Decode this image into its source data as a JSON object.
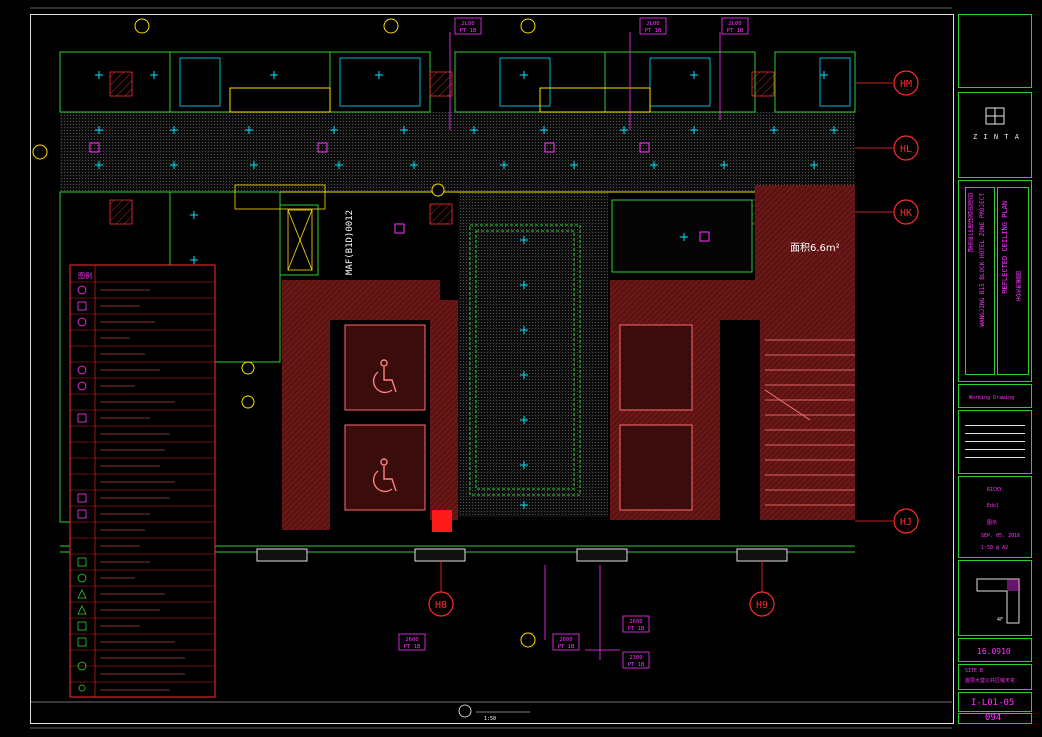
{
  "drawing": {
    "area_label": "面积6.6m²",
    "equipment_tag": "MAF(B1D)0012",
    "grid_lines_right": [
      "HM",
      "HL",
      "HK",
      "HJ"
    ],
    "grid_lines_bottom": [
      "H8",
      "H9"
    ],
    "ceiling_tags_top": [
      {
        "height": "2L00",
        "code": "PT 1B"
      },
      {
        "height": "2L00",
        "code": "PT 1B"
      },
      {
        "height": "2L00",
        "code": "PT 1B"
      }
    ],
    "ceiling_tags_bottom": [
      {
        "height": "2600",
        "code": "PT 1B"
      },
      {
        "height": "2600",
        "code": "PT 1B"
      },
      {
        "height": "2600",
        "code": "PT 1B"
      },
      {
        "height": "2300",
        "code": "PT 1B"
      }
    ],
    "legend_title": "图例",
    "scale_label": "1:50"
  },
  "title_block": {
    "firm_label": "",
    "firm_name": "Z I N T A",
    "project_cn": "望京B15地块酒店项目",
    "project_en": "WANGJING B15 BLOCK HOTEL ZONE PROJECT",
    "drawing_title_en": "REFLECTED CEILING PLAN",
    "drawing_title_cn": "天花布置图",
    "status_label": "",
    "status": "Working Drawing",
    "drawn": "RICKY",
    "checked": "Edol",
    "scale": "图示",
    "date": "SEP. 05. 2016",
    "sheet_size": "1:50 @ A2",
    "key_plan_label": "4F",
    "project_no": "16.0910",
    "area_code": "SITE B",
    "area_desc": "首层大堂公共区域天花",
    "sheet_no": "I-L01-05",
    "page_no": "094"
  },
  "colors": {
    "frame": "#e0e0e0",
    "green": "#2bd12b",
    "magenta": "#ff33ff",
    "red": "#ff2b2b",
    "cyan": "#00e5ff",
    "yellow": "#ffe000",
    "wall_fill": "#5a1414"
  }
}
